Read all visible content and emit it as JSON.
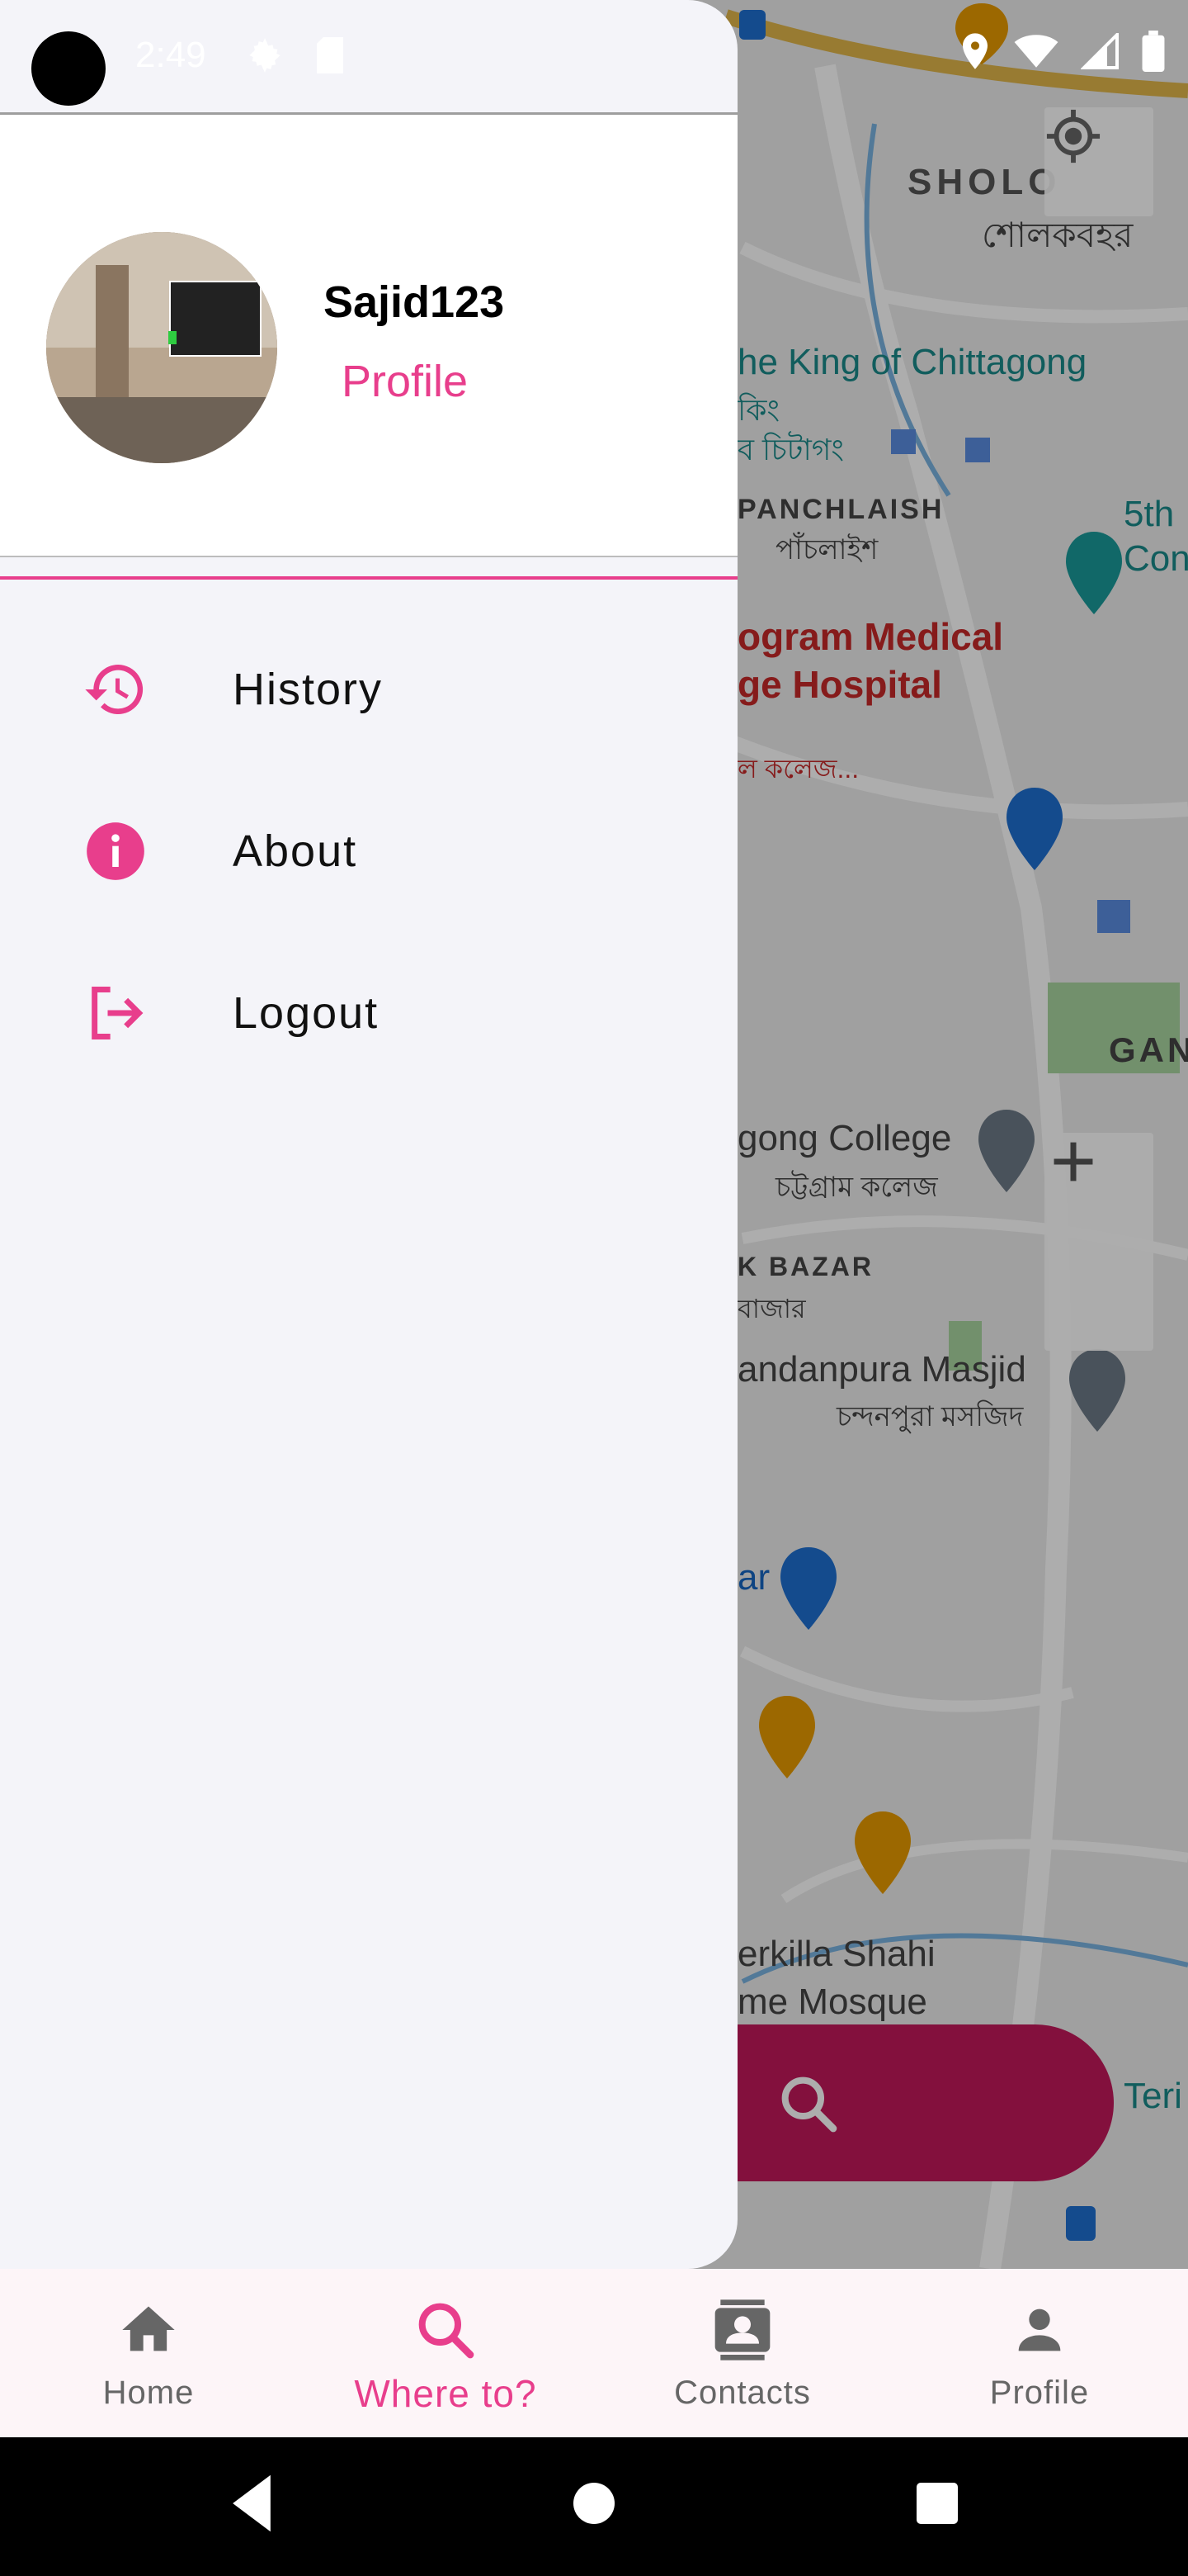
{
  "status_bar": {
    "time": "2:49",
    "icons": [
      "settings-icon",
      "sd-card-icon",
      "location-icon",
      "wifi-icon",
      "signal-icon",
      "battery-icon"
    ]
  },
  "drawer": {
    "user": {
      "username": "Sajid123",
      "profile_link": "Profile"
    },
    "menu": [
      {
        "label": "History",
        "icon": "history-icon"
      },
      {
        "label": "About",
        "icon": "info-icon"
      },
      {
        "label": "Logout",
        "icon": "logout-icon"
      }
    ]
  },
  "map": {
    "labels": {
      "sholokbahar": "SHOLO",
      "sholokbahar_bn": "শোলকবহর",
      "king": "he King of Chittagong",
      "king_bn1": "কিং",
      "king_bn2": "ব চিটাগং",
      "panchlaish": "PANCHLAISH",
      "panchlaish_bn": "পাঁচলাইশ",
      "fifth": "5th",
      "con": "Con",
      "medical1": "ogram Medical",
      "medical2": "ge Hospital",
      "college_bn": "ল কলেজ...",
      "gan": "GAN",
      "college": "gong College",
      "college_bn2": "চট্টগ্রাম কলেজ",
      "bazar": "K BAZAR",
      "bazar_bn": "বাজার",
      "masjid": "andanpura Masjid",
      "masjid_bn": "চন্দনপুরা মসজিদ",
      "ar": "ar",
      "shahi1": "erkilla Shahi",
      "shahi2": "me Mosque",
      "teri": "Teri"
    }
  },
  "bottom_nav": {
    "items": [
      {
        "label": "Home",
        "icon": "home-icon",
        "active": false
      },
      {
        "label": "Where to?",
        "icon": "search-icon",
        "active": true
      },
      {
        "label": "Contacts",
        "icon": "contacts-icon",
        "active": false
      },
      {
        "label": "Profile",
        "icon": "person-icon",
        "active": false
      }
    ]
  },
  "colors": {
    "accent": "#e83e8c",
    "drawer_bg": "#f4f4f9",
    "nav_bg": "#fdf5f8"
  }
}
